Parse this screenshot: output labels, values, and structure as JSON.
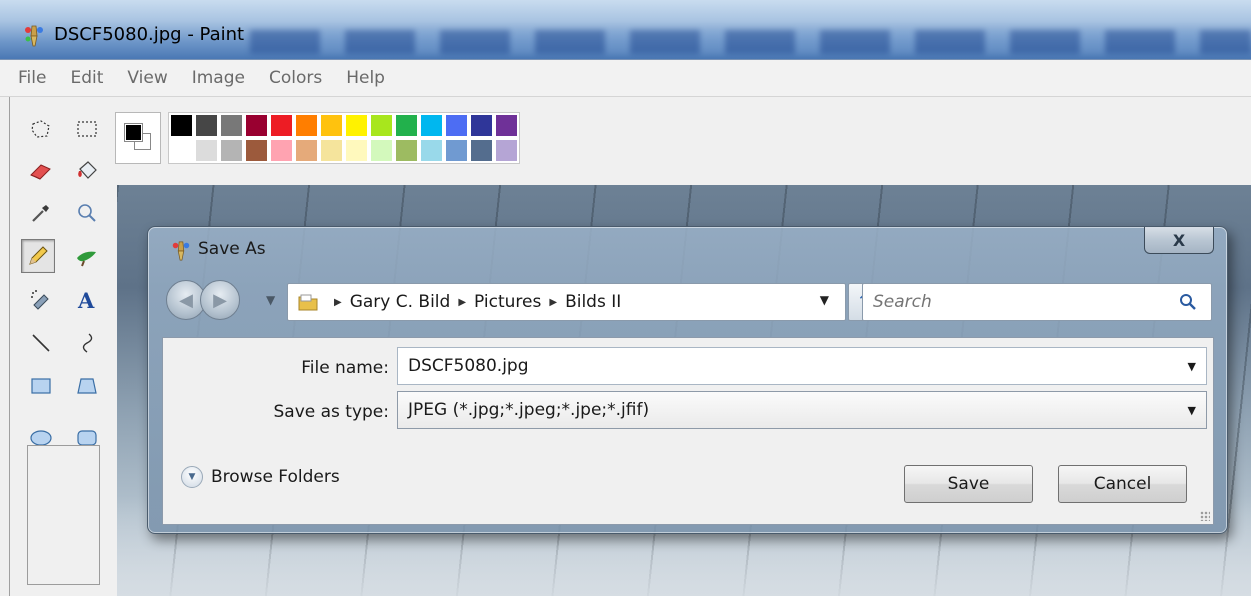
{
  "window": {
    "title": "DSCF5080.jpg - Paint"
  },
  "menu": [
    "File",
    "Edit",
    "View",
    "Image",
    "Colors",
    "Help"
  ],
  "palette": {
    "foreground": "#000000",
    "background": "#ffffff",
    "row1": [
      "#000000",
      "#464646",
      "#787878",
      "#990030",
      "#ed1c24",
      "#ff7e00",
      "#ffc20e",
      "#fff200",
      "#a8e61d",
      "#22b14c",
      "#00b7ef",
      "#4d6df3",
      "#2f3699",
      "#6f3198"
    ],
    "row2": [
      "#ffffff",
      "#dcdcdc",
      "#b4b4b4",
      "#9c5a3c",
      "#ffa3b1",
      "#e5aa7a",
      "#f5e49c",
      "#fff9bd",
      "#d3f9bc",
      "#9dbb61",
      "#99d9ea",
      "#709ad1",
      "#546d8e",
      "#b5a5d5"
    ]
  },
  "dialog": {
    "title": "Save As",
    "close_label": "X",
    "breadcrumbs": [
      "Gary C. Bild",
      "Pictures",
      "Bilds II"
    ],
    "search_placeholder": "Search",
    "file_name_label": "File name:",
    "file_name_value": "DSCF5080.jpg",
    "save_type_label": "Save as type:",
    "save_type_value": "JPEG (*.jpg;*.jpeg;*.jpe;*.jfif)",
    "browse_label": "Browse Folders",
    "save_label": "Save",
    "cancel_label": "Cancel"
  }
}
